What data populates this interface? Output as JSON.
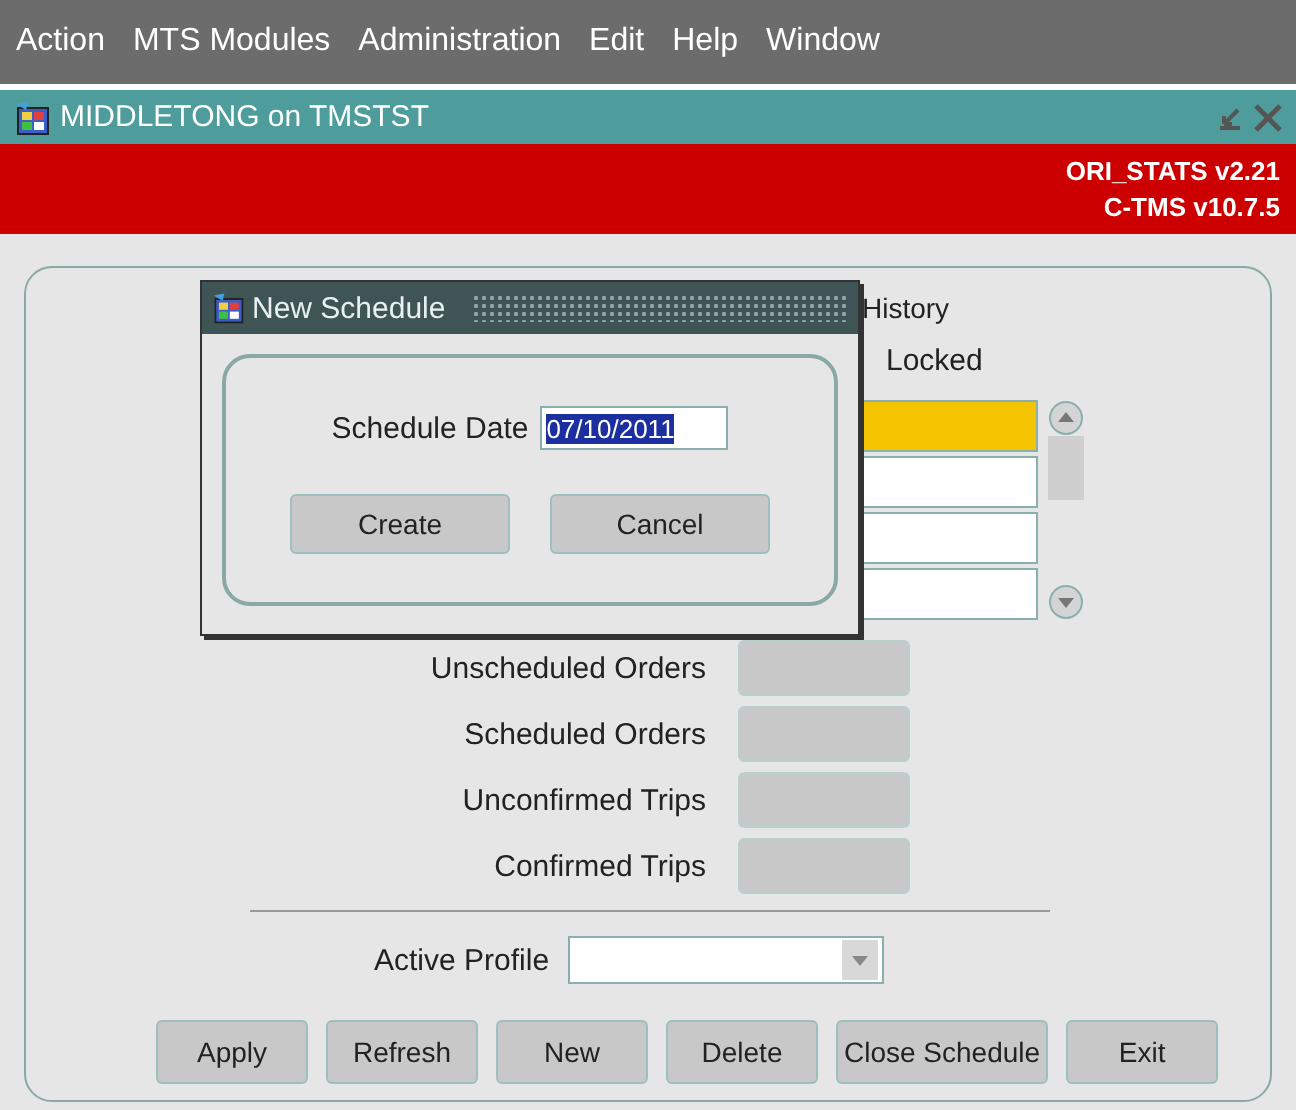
{
  "menu": [
    "Action",
    "MTS Modules",
    "Administration",
    "Edit",
    "Help",
    "Window"
  ],
  "window": {
    "title": "MIDDLETONG on TMSTST"
  },
  "banner": [
    "ORI_STATS v2.21",
    "C-TMS v10.7.5"
  ],
  "panel": {
    "history_label": "History",
    "locked_label": "Locked",
    "locked_rows": [
      {
        "selected": true
      },
      {
        "selected": false
      },
      {
        "selected": false
      },
      {
        "selected": false
      }
    ],
    "stats": [
      "Unscheduled Orders",
      "Scheduled Orders",
      "Unconfirmed Trips",
      "Confirmed Trips"
    ],
    "active_profile_label": "Active Profile",
    "buttons": [
      "Apply",
      "Refresh",
      "New",
      "Delete",
      "Close Schedule",
      "Exit"
    ]
  },
  "dialog": {
    "title": "New Schedule",
    "date_label": "Schedule Date",
    "date_value": "07/10/2011",
    "date_highlighted": true,
    "buttons": [
      "Create",
      "Cancel"
    ]
  }
}
